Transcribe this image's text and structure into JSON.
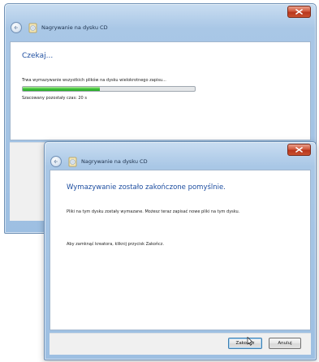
{
  "window_back": {
    "title": "Nagrywanie na dysku CD",
    "heading": "Czekaj...",
    "status": "Trwa wymazywanie wszystkich plików na dysku wielokrotnego zapisu...",
    "progress": 0.45,
    "progress_color": "#3fc13a",
    "remaining": "Szacowany pozostały czas: 20 s"
  },
  "window_front": {
    "title": "Nagrywanie na dysku CD",
    "heading": "Wymazywanie zostało zakończone pomyślnie.",
    "message1": "Pliki na tym dysku zostały wymazane. Możesz teraz zapisać nowe pliki na tym dysku.",
    "message2": "Aby zamknąć kreatora, kliknij przycisk Zakończ.",
    "finish_label": "Zakończ",
    "cancel_label": "Anuluj"
  },
  "colors": {
    "heading": "#1e4ea0",
    "frame": "#a9c7e6",
    "close": "#c9502f"
  },
  "icons": [
    "back-arrow-icon",
    "cd-disc-icon",
    "close-icon",
    "mouse-pointer-icon"
  ]
}
